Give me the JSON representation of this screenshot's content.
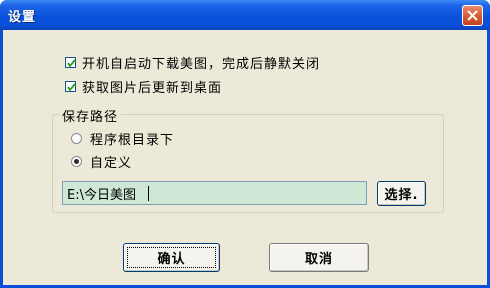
{
  "window": {
    "title": "设置"
  },
  "options": [
    {
      "label": "开机自启动下载美图，完成后静默关闭",
      "checked": true
    },
    {
      "label": "获取图片后更新到桌面",
      "checked": true
    }
  ],
  "save_path": {
    "group_label": "保存路径",
    "radios": [
      {
        "label": "程序根目录下",
        "selected": false
      },
      {
        "label": "自定义",
        "selected": true
      }
    ],
    "path_value": "E:\\今日美图",
    "choose_label": "选择."
  },
  "buttons": {
    "ok": "确认",
    "cancel": "取消"
  }
}
